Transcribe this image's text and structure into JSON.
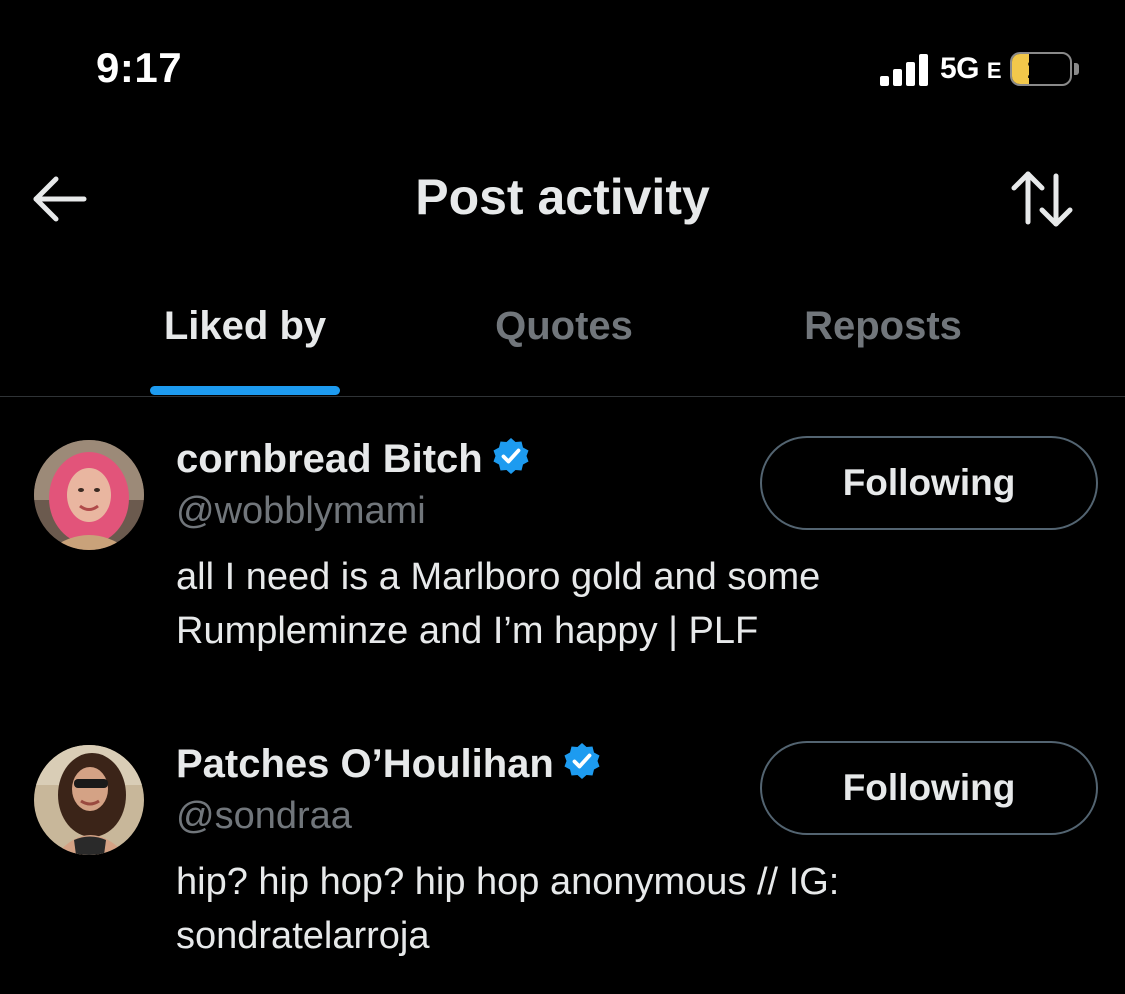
{
  "status_bar": {
    "time": "9:17",
    "network": "5G",
    "network_suffix": "E",
    "battery_level": "15",
    "battery_color": "#f2c84b"
  },
  "header": {
    "title": "Post activity",
    "back_icon": "arrow-left-icon",
    "sort_icon": "sort-up-down-icon"
  },
  "tabs": [
    {
      "label": "Liked by",
      "active": true
    },
    {
      "label": "Quotes",
      "active": false
    },
    {
      "label": "Reposts",
      "active": false
    }
  ],
  "accent_color": "#1d9bf0",
  "users": [
    {
      "display_name": "cornbread Bitch",
      "verified": true,
      "handle": "@wobblymami",
      "bio_line1": "all I need is a Marlboro gold and some",
      "bio_line2": "Rumpleminze and I’m happy | PLF",
      "follow_label": "Following"
    },
    {
      "display_name": "Patches O’Houlihan",
      "verified": true,
      "handle": "@sondraa",
      "bio_line1": "hip? hip hop? hip hop anonymous // IG:",
      "bio_line2": "sondratelarroja",
      "follow_label": "Following"
    }
  ]
}
